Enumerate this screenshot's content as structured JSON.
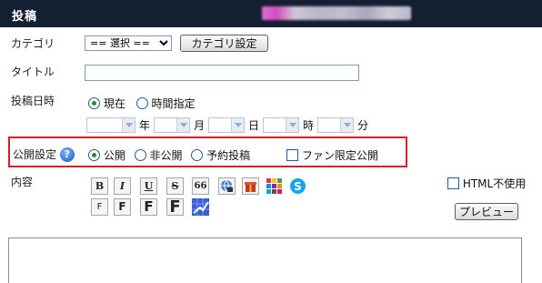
{
  "header": {
    "title": "投稿"
  },
  "category": {
    "label": "カテゴリ",
    "select_value": "== 選択 ==",
    "settings_button": "カテゴリ設定"
  },
  "title_field": {
    "label": "タイトル",
    "value": ""
  },
  "post_date": {
    "label": "投稿日時",
    "options": [
      {
        "label": "現在",
        "selected": true
      },
      {
        "label": "時間指定",
        "selected": false
      }
    ],
    "units": {
      "year": "年",
      "month": "月",
      "day": "日",
      "hour": "時",
      "minute": "分"
    }
  },
  "visibility": {
    "label": "公開設定",
    "help_icon": "?",
    "options": [
      {
        "label": "公開",
        "selected": true
      },
      {
        "label": "非公開",
        "selected": false
      },
      {
        "label": "予約投稿",
        "selected": false
      }
    ],
    "fan_only": {
      "label": "ファン限定公開",
      "checked": false
    }
  },
  "content": {
    "label": "内容",
    "html_disable": {
      "label": "HTML不使用",
      "checked": false
    },
    "preview_button": "プレビュー",
    "toolbar_row1": [
      "B",
      "I",
      "U",
      "S",
      "66"
    ],
    "toolbar_row2": [
      "F",
      "F",
      "F",
      "F"
    ]
  },
  "colors": {
    "header_bg": "#141f31",
    "highlight_border": "#d51f28"
  }
}
